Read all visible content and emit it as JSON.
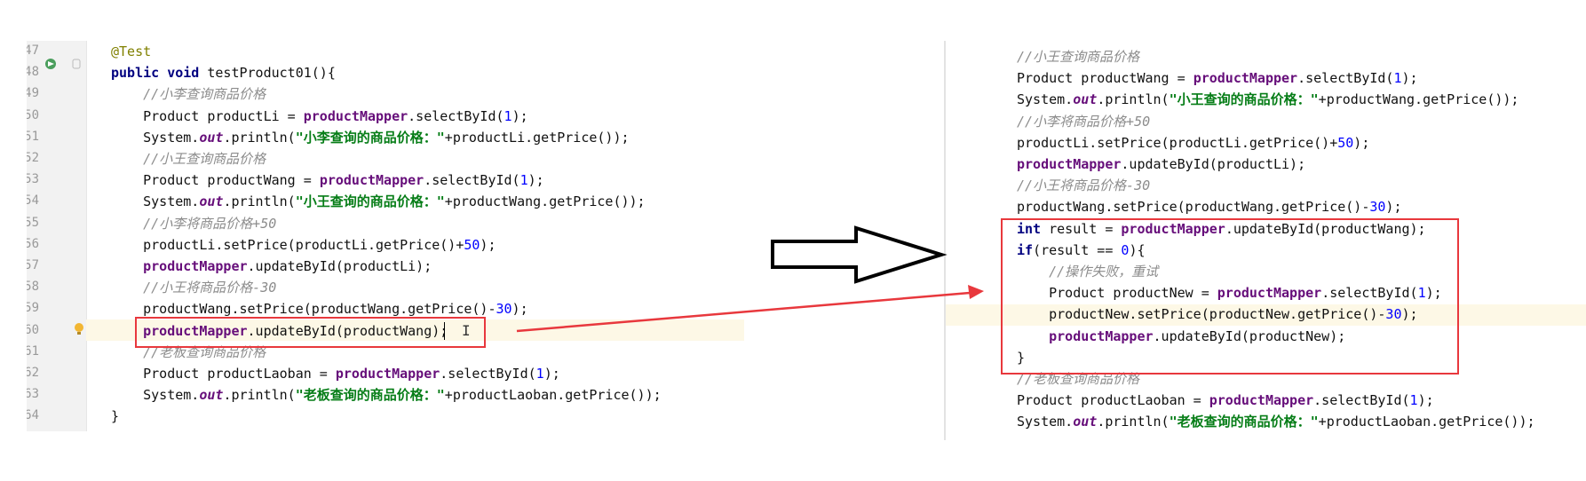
{
  "colors": {
    "annotation_red": "#e8383d",
    "keyword": "#000080",
    "field": "#660e7a",
    "string": "#067d17",
    "comment": "#8c8c8c",
    "number": "#0000ff",
    "line_highlight": "#fdf8e6"
  },
  "left_editor": {
    "line_numbers": [
      "47",
      "48",
      "49",
      "50",
      "51",
      "52",
      "53",
      "54",
      "55",
      "56",
      "57",
      "58",
      "59",
      "60",
      "61",
      "62",
      "63",
      "64"
    ],
    "lines": [
      [
        {
          "t": "@Test",
          "c": "a"
        }
      ],
      [
        {
          "t": "public void ",
          "c": "k"
        },
        {
          "t": "testProduct01(){",
          "c": ""
        }
      ],
      [
        {
          "t": "    //小李查询商品价格",
          "c": "c"
        }
      ],
      [
        {
          "t": "    Product productLi = ",
          "c": ""
        },
        {
          "t": "productMapper",
          "c": "m"
        },
        {
          "t": ".selectById(",
          "c": ""
        },
        {
          "t": "1",
          "c": "n"
        },
        {
          "t": ");",
          "c": ""
        }
      ],
      [
        {
          "t": "    System.",
          "c": ""
        },
        {
          "t": "out",
          "c": "o"
        },
        {
          "t": ".println(",
          "c": ""
        },
        {
          "t": "\"小李查询的商品价格：\"",
          "c": "s"
        },
        {
          "t": "+productLi.getPrice());",
          "c": ""
        }
      ],
      [
        {
          "t": "    //小王查询商品价格",
          "c": "c"
        }
      ],
      [
        {
          "t": "    Product productWang = ",
          "c": ""
        },
        {
          "t": "productMapper",
          "c": "m"
        },
        {
          "t": ".selectById(",
          "c": ""
        },
        {
          "t": "1",
          "c": "n"
        },
        {
          "t": ");",
          "c": ""
        }
      ],
      [
        {
          "t": "    System.",
          "c": ""
        },
        {
          "t": "out",
          "c": "o"
        },
        {
          "t": ".println(",
          "c": ""
        },
        {
          "t": "\"小王查询的商品价格：\"",
          "c": "s"
        },
        {
          "t": "+productWang.getPrice());",
          "c": ""
        }
      ],
      [
        {
          "t": "    //小李将商品价格+50",
          "c": "c"
        }
      ],
      [
        {
          "t": "    productLi.setPrice(productLi.getPrice()+",
          "c": ""
        },
        {
          "t": "50",
          "c": "n"
        },
        {
          "t": ");",
          "c": ""
        }
      ],
      [
        {
          "t": "    ",
          "c": ""
        },
        {
          "t": "productMapper",
          "c": "m"
        },
        {
          "t": ".updateById(productLi);",
          "c": ""
        }
      ],
      [
        {
          "t": "    //小王将商品价格-30",
          "c": "c"
        }
      ],
      [
        {
          "t": "    productWang.setPrice(productWang.getPrice()-",
          "c": ""
        },
        {
          "t": "30",
          "c": "n"
        },
        {
          "t": ");",
          "c": ""
        }
      ],
      [
        {
          "t": "    ",
          "c": ""
        },
        {
          "t": "productMapper",
          "c": "m"
        },
        {
          "t": ".updateById(productWang);",
          "c": ""
        }
      ],
      [
        {
          "t": "    //老板查询商品价格",
          "c": "c"
        }
      ],
      [
        {
          "t": "    Product productLaoban = ",
          "c": ""
        },
        {
          "t": "productMapper",
          "c": "m"
        },
        {
          "t": ".selectById(",
          "c": ""
        },
        {
          "t": "1",
          "c": "n"
        },
        {
          "t": ");",
          "c": ""
        }
      ],
      [
        {
          "t": "    System.",
          "c": ""
        },
        {
          "t": "out",
          "c": "o"
        },
        {
          "t": ".println(",
          "c": ""
        },
        {
          "t": "\"老板查询的商品价格：\"",
          "c": "s"
        },
        {
          "t": "+productLaoban.getPrice());",
          "c": ""
        }
      ],
      [
        {
          "t": "}",
          "c": ""
        }
      ]
    ]
  },
  "right_editor": {
    "lines": [
      [
        {
          "t": "//小王查询商品价格",
          "c": "c"
        }
      ],
      [
        {
          "t": "Product productWang = ",
          "c": ""
        },
        {
          "t": "productMapper",
          "c": "m"
        },
        {
          "t": ".selectById(",
          "c": ""
        },
        {
          "t": "1",
          "c": "n"
        },
        {
          "t": ");",
          "c": ""
        }
      ],
      [
        {
          "t": "System.",
          "c": ""
        },
        {
          "t": "out",
          "c": "o"
        },
        {
          "t": ".println(",
          "c": ""
        },
        {
          "t": "\"小王查询的商品价格：\"",
          "c": "s"
        },
        {
          "t": "+productWang.getPrice());",
          "c": ""
        }
      ],
      [
        {
          "t": "//小李将商品价格+50",
          "c": "c"
        }
      ],
      [
        {
          "t": "productLi.setPrice(productLi.getPrice()+",
          "c": ""
        },
        {
          "t": "50",
          "c": "n"
        },
        {
          "t": ");",
          "c": ""
        }
      ],
      [
        {
          "t": "productMapper",
          "c": "m"
        },
        {
          "t": ".updateById(productLi);",
          "c": ""
        }
      ],
      [
        {
          "t": "//小王将商品价格-30",
          "c": "c"
        }
      ],
      [
        {
          "t": "productWang.setPrice(productWang.getPrice()-",
          "c": ""
        },
        {
          "t": "30",
          "c": "n"
        },
        {
          "t": ");",
          "c": ""
        }
      ],
      [
        {
          "t": "int ",
          "c": "k"
        },
        {
          "t": "result = ",
          "c": ""
        },
        {
          "t": "productMapper",
          "c": "m"
        },
        {
          "t": ".updateById(productWang);",
          "c": ""
        }
      ],
      [
        {
          "t": "if",
          "c": "k"
        },
        {
          "t": "(result == ",
          "c": ""
        },
        {
          "t": "0",
          "c": "n"
        },
        {
          "t": "){",
          "c": ""
        }
      ],
      [
        {
          "t": "    //操作失败，重试",
          "c": "c"
        }
      ],
      [
        {
          "t": "    Product productNew = ",
          "c": ""
        },
        {
          "t": "productMapper",
          "c": "m"
        },
        {
          "t": ".selectById(",
          "c": ""
        },
        {
          "t": "1",
          "c": "n"
        },
        {
          "t": ");",
          "c": ""
        }
      ],
      [
        {
          "t": "    productNew.setPrice(productNew.getPrice()-",
          "c": ""
        },
        {
          "t": "30",
          "c": "n"
        },
        {
          "t": ");",
          "c": ""
        }
      ],
      [
        {
          "t": "    ",
          "c": ""
        },
        {
          "t": "productMapper",
          "c": "m"
        },
        {
          "t": ".updateById(productNew);",
          "c": ""
        }
      ],
      [
        {
          "t": "}",
          "c": ""
        }
      ],
      [
        {
          "t": "//老板查询商品价格",
          "c": "c"
        }
      ],
      [
        {
          "t": "Product productLaoban = ",
          "c": ""
        },
        {
          "t": "productMapper",
          "c": "m"
        },
        {
          "t": ".selectById(",
          "c": ""
        },
        {
          "t": "1",
          "c": "n"
        },
        {
          "t": ");",
          "c": ""
        }
      ],
      [
        {
          "t": "System.",
          "c": ""
        },
        {
          "t": "out",
          "c": "o"
        },
        {
          "t": ".println(",
          "c": ""
        },
        {
          "t": "\"老板查询的商品价格：\"",
          "c": "s"
        },
        {
          "t": "+productLaoban.getPrice());",
          "c": ""
        }
      ]
    ]
  }
}
